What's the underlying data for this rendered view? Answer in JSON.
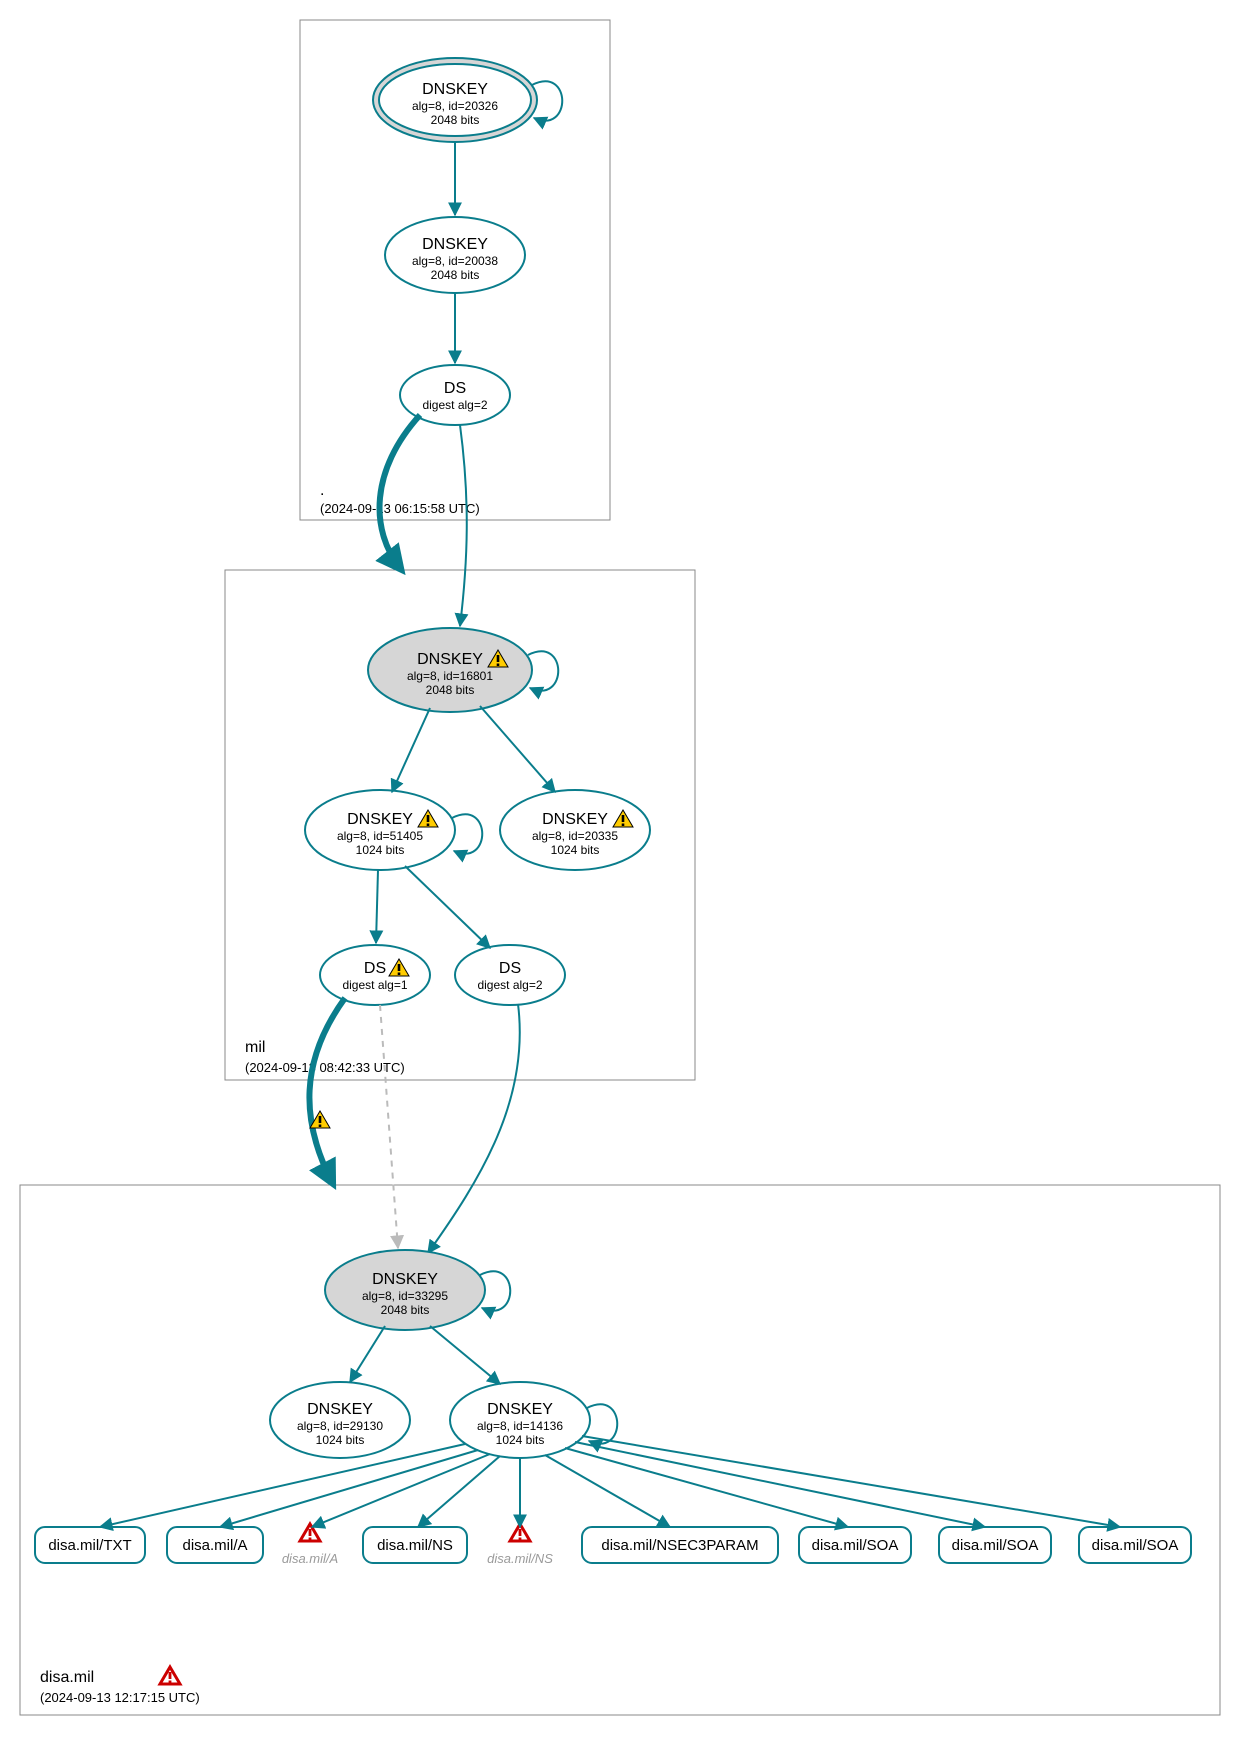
{
  "colors": {
    "accent": "#0a7d8c",
    "node_fill_grey": "#d6d6d6",
    "warn": "#ffcc00",
    "err": "#cc0000"
  },
  "zones": {
    "root": {
      "label": ".",
      "timestamp": "(2024-09-13 06:15:58 UTC)"
    },
    "mil": {
      "label": "mil",
      "timestamp": "(2024-09-13 08:42:33 UTC)"
    },
    "disa": {
      "label": "disa.mil",
      "timestamp": "(2024-09-13 12:17:15 UTC)"
    }
  },
  "nodes": {
    "root_ksk": {
      "title": "DNSKEY",
      "line2": "alg=8, id=20326",
      "line3": "2048 bits"
    },
    "root_zsk": {
      "title": "DNSKEY",
      "line2": "alg=8, id=20038",
      "line3": "2048 bits"
    },
    "root_ds": {
      "title": "DS",
      "line2": "digest alg=2"
    },
    "mil_ksk": {
      "title": "DNSKEY",
      "line2": "alg=8, id=16801",
      "line3": "2048 bits",
      "warn": true
    },
    "mil_zsk1": {
      "title": "DNSKEY",
      "line2": "alg=8, id=51405",
      "line3": "1024 bits",
      "warn": true
    },
    "mil_zsk2": {
      "title": "DNSKEY",
      "line2": "alg=8, id=20335",
      "line3": "1024 bits",
      "warn": true
    },
    "mil_ds1": {
      "title": "DS",
      "line2": "digest alg=1",
      "warn": true
    },
    "mil_ds2": {
      "title": "DS",
      "line2": "digest alg=2"
    },
    "disa_ksk": {
      "title": "DNSKEY",
      "line2": "alg=8, id=33295",
      "line3": "2048 bits"
    },
    "disa_zsk1": {
      "title": "DNSKEY",
      "line2": "alg=8, id=29130",
      "line3": "1024 bits"
    },
    "disa_zsk2": {
      "title": "DNSKEY",
      "line2": "alg=8, id=14136",
      "line3": "1024 bits"
    }
  },
  "rr": {
    "txt": "disa.mil/TXT",
    "a": "disa.mil/A",
    "a_err": "disa.mil/A",
    "ns": "disa.mil/NS",
    "ns_err": "disa.mil/NS",
    "n3p": "disa.mil/NSEC3PARAM",
    "soa1": "disa.mil/SOA",
    "soa2": "disa.mil/SOA",
    "soa3": "disa.mil/SOA"
  }
}
